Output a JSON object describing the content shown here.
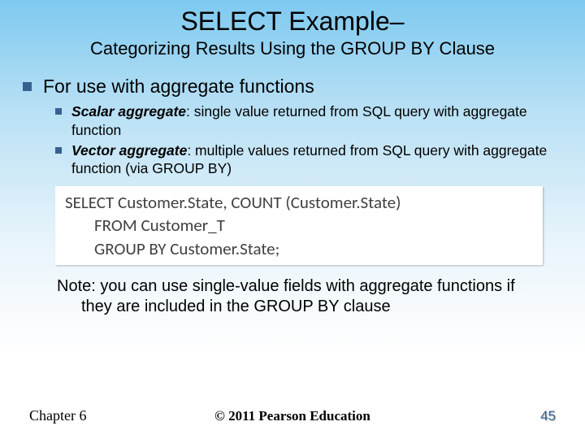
{
  "title": "SELECT Example–",
  "subtitle": "Categorizing Results Using the GROUP BY Clause",
  "l1": "For use with aggregate functions",
  "sub1_term": "Scalar aggregate",
  "sub1_rest": ": single value returned from SQL query with aggregate function",
  "sub2_term": "Vector aggregate",
  "sub2_rest": ": multiple values returned from SQL query with aggregate function (via GROUP BY)",
  "code_line1": "SELECT Customer.State, COUNT (Customer.State)",
  "code_line2": "FROM Customer_T",
  "code_line3": "GROUP BY Customer.State;",
  "note": "Note: you can use single-value fields with aggregate functions if they are included in the GROUP BY clause",
  "footer": {
    "chapter": "Chapter 6",
    "copyright": "© 2011 Pearson Education",
    "page": "45"
  }
}
